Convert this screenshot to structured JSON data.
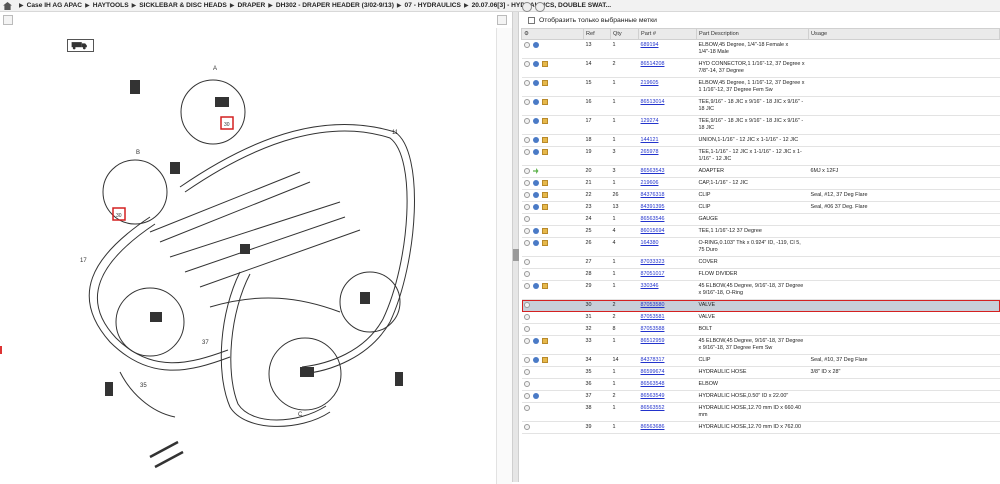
{
  "breadcrumb": [
    "Case IH AG APAC",
    "HAYTOOLS",
    "SICKLEBAR & DISC HEADS",
    "DRAPER",
    "DH302 - DRAPER HEADER (3/02-9/13)",
    "07 - HYDRAULICS",
    "20.07.06[3] - HYDRAULICS, DOUBLE SWAT..."
  ],
  "filter_label": "Отобразить только выбранные метки",
  "columns": [
    "",
    "Ref",
    "Qty",
    "Part #",
    "Part Description",
    "Usage"
  ],
  "rows": [
    {
      "ref": "13",
      "qty": "1",
      "part": "689194",
      "desc": "ELBOW,45 Degree, 1/4\"-18 Female x 1/4\"-18 Male",
      "usage": "",
      "icons": [
        "o",
        "h"
      ]
    },
    {
      "ref": "14",
      "qty": "2",
      "part": "86514208",
      "desc": "HYD CONNECTOR,1 1/16\"-12, 37 Degree x 7/8\"-14, 37 Degree",
      "usage": "",
      "icons": [
        "o",
        "h",
        "c"
      ]
    },
    {
      "ref": "15",
      "qty": "1",
      "part": "219605",
      "desc": "ELBOW,45 Degree, 1 1/16\"-12, 37 Degree x 1 1/16\"-12, 37 Degree Fem Sw",
      "usage": "",
      "icons": [
        "o",
        "h",
        "c"
      ]
    },
    {
      "ref": "16",
      "qty": "1",
      "part": "86513014",
      "desc": "TEE,9/16\" - 18 JIC x 9/16\" - 18 JIC x 9/16\" - 18 JIC",
      "usage": "",
      "icons": [
        "o",
        "h",
        "c"
      ]
    },
    {
      "ref": "17",
      "qty": "1",
      "part": "129274",
      "desc": "TEE,9/16\" - 18 JIC x 9/16\" - 18 JIC x 9/16\" - 18 JIC",
      "usage": "",
      "icons": [
        "o",
        "h",
        "c"
      ]
    },
    {
      "ref": "18",
      "qty": "1",
      "part": "144121",
      "desc": "UNION,1-1/16\" - 12 JIC x 1-1/16\" - 12 JIC",
      "usage": "",
      "icons": [
        "o",
        "h",
        "c"
      ]
    },
    {
      "ref": "19",
      "qty": "3",
      "part": "265978",
      "desc": "TEE,1-1/16\" - 12 JIC x 1-1/16\" - 12 JIC x 1-1/16\" - 12 JIC",
      "usage": "",
      "icons": [
        "o",
        "h",
        "c"
      ]
    },
    {
      "ref": "20",
      "qty": "3",
      "part": "86563543",
      "desc": "ADAPTER",
      "usage": "6MJ x 12FJ",
      "icons": [
        "o",
        "g"
      ]
    },
    {
      "ref": "21",
      "qty": "1",
      "part": "219606",
      "desc": "CAP,1-1/16\" - 12 JIC",
      "usage": "",
      "icons": [
        "o",
        "h",
        "c"
      ]
    },
    {
      "ref": "22",
      "qty": "26",
      "part": "84376318",
      "desc": "CLIP",
      "usage": "Seal, #12, 37 Deg Flare",
      "icons": [
        "o",
        "h",
        "c"
      ]
    },
    {
      "ref": "23",
      "qty": "13",
      "part": "84391395",
      "desc": "CLIP",
      "usage": "Seal, #06 37 Deg. Flare",
      "icons": [
        "o",
        "h",
        "c"
      ]
    },
    {
      "ref": "24",
      "qty": "1",
      "part": "86563546",
      "desc": "GAUGE",
      "usage": "",
      "icons": [
        "o"
      ]
    },
    {
      "ref": "25",
      "qty": "4",
      "part": "86015694",
      "desc": "TEE,1 1/16\"-12 37 Degree",
      "usage": "",
      "icons": [
        "o",
        "h",
        "c"
      ]
    },
    {
      "ref": "26",
      "qty": "4",
      "part": "164380",
      "desc": "O-RING,0.103\" Thk x 0.924\" ID, -119, Cl 5, 75 Duro",
      "usage": "",
      "icons": [
        "o",
        "h",
        "c"
      ]
    },
    {
      "ref": "27",
      "qty": "1",
      "part": "87033323",
      "desc": "COVER",
      "usage": "",
      "icons": [
        "o"
      ]
    },
    {
      "ref": "28",
      "qty": "1",
      "part": "87051017",
      "desc": "FLOW DIVIDER",
      "usage": "",
      "icons": [
        "o"
      ]
    },
    {
      "ref": "29",
      "qty": "1",
      "part": "330346",
      "desc": "45 ELBOW,45 Degree, 9/16\"-18, 37 Degree x 9/16\"-18, O-Ring",
      "usage": "",
      "icons": [
        "o",
        "h",
        "c"
      ]
    },
    {
      "ref": "30",
      "qty": "2",
      "part": "87053580",
      "desc": "VALVE",
      "usage": "",
      "icons": [
        "o"
      ],
      "selected": true
    },
    {
      "ref": "31",
      "qty": "2",
      "part": "87053581",
      "desc": "VALVE",
      "usage": "",
      "icons": [
        "o"
      ]
    },
    {
      "ref": "32",
      "qty": "8",
      "part": "87053588",
      "desc": "BOLT",
      "usage": "",
      "icons": [
        "o"
      ]
    },
    {
      "ref": "33",
      "qty": "1",
      "part": "86512959",
      "desc": "45 ELBOW,45 Degree, 9/16\"-18, 37 Degree x 9/16\"-18, 37 Degree Fem Sw",
      "usage": "",
      "icons": [
        "o",
        "h",
        "c"
      ]
    },
    {
      "ref": "34",
      "qty": "14",
      "part": "84378317",
      "desc": "CLIP",
      "usage": "Seal, #10, 37 Deg Flare",
      "icons": [
        "o",
        "h",
        "c"
      ]
    },
    {
      "ref": "35",
      "qty": "1",
      "part": "86599674",
      "desc": "HYDRAULIC HOSE",
      "usage": "3/8\" ID x 28\"",
      "icons": [
        "o"
      ]
    },
    {
      "ref": "36",
      "qty": "1",
      "part": "86563548",
      "desc": "ELBOW",
      "usage": "",
      "icons": [
        "o"
      ]
    },
    {
      "ref": "37",
      "qty": "2",
      "part": "86563549",
      "desc": "HYDRAULIC HOSE,0.50\" ID x 22.00\"",
      "usage": "",
      "icons": [
        "o",
        "h"
      ]
    },
    {
      "ref": "38",
      "qty": "1",
      "part": "86563552",
      "desc": "HYDRAULIC HOSE,12.70 mm ID x 660.40 mm",
      "usage": "",
      "icons": [
        "o"
      ]
    },
    {
      "ref": "39",
      "qty": "1",
      "part": "86563686",
      "desc": "HYDRAULIC HOSE,12.70 mm ID x 762.00",
      "usage": "",
      "icons": [
        "o"
      ]
    }
  ],
  "diagram_callouts": [
    "A",
    "B",
    "C",
    "11",
    "17",
    "37",
    "35",
    "30",
    "30"
  ]
}
